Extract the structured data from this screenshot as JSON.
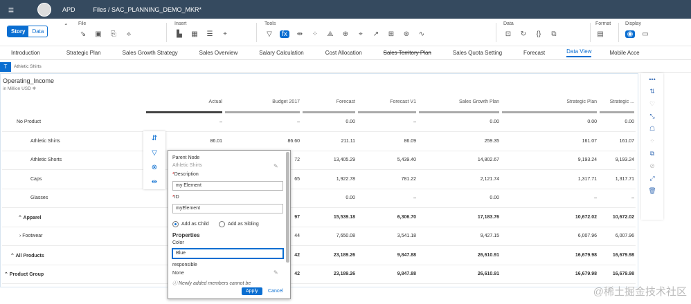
{
  "shell": {
    "app": "APD",
    "crumb": "Files  /  SAC_PLANNING_DEMO_MKR*"
  },
  "toolbar": {
    "story": "Story",
    "data": "Data",
    "groups": [
      {
        "label": "File",
        "icons": [
          "⇘",
          "▣",
          "⎘",
          "⟡"
        ]
      },
      {
        "label": "Insert",
        "icons": [
          "▙",
          "▦",
          "☰",
          "+"
        ]
      },
      {
        "label": "Tools",
        "icons": [
          "▽",
          "fx",
          "⇹",
          "⁘",
          "⟁",
          "⊕",
          "⌖",
          "↗",
          "⊞",
          "⊛",
          "∿"
        ]
      },
      {
        "label": "Data",
        "icons": [
          "⊡",
          "↻",
          "{}",
          "⧉"
        ]
      },
      {
        "label": "Format",
        "icons": [
          "▤"
        ]
      },
      {
        "label": "Display",
        "icons": [
          "◉",
          "▭"
        ]
      }
    ]
  },
  "tabs": [
    "Introduction",
    "Strategic Plan",
    "Sales Growth Strategy",
    "Sales Overview",
    "Salary Calculation",
    "Cost Allocation",
    "Sales Territory Plan",
    "Sales Quota Setting",
    "Forecast",
    "Data View",
    "Mobile Acce"
  ],
  "formula": {
    "badge": "T",
    "value": "Athletic Shirts"
  },
  "table": {
    "title": "Operating_Income",
    "subtitle": "in Million USD  ❄",
    "columns": [
      "Actual",
      "Budget 2017",
      "Forecast",
      "Forecast V1",
      "Sales Growth Plan",
      "Strategic Plan",
      "Strategic ..."
    ],
    "rows": [
      {
        "label": "No Product",
        "values": [
          "–",
          "–",
          "0.00",
          "–",
          "0.00",
          "0.00",
          "0.00"
        ]
      },
      {
        "label": "Athletic Shirts",
        "values": [
          "86.01",
          "86.60",
          "211.11",
          "86.09",
          "259.35",
          "161.07",
          "161.07"
        ]
      },
      {
        "label": "Athletic Shorts",
        "values": [
          "",
          "72",
          "13,405.29",
          "5,439.40",
          "14,802.67",
          "9,193.24",
          "9,193.24"
        ]
      },
      {
        "label": "Caps",
        "values": [
          "",
          "65",
          "1,922.78",
          "781.22",
          "2,121.74",
          "1,317.71",
          "1,317.71"
        ]
      },
      {
        "label": "Glasses",
        "values": [
          "",
          "",
          "0.00",
          "–",
          "0.00",
          "–",
          "–"
        ]
      },
      {
        "label": "⌃ Apparel",
        "values": [
          "",
          "97",
          "15,539.18",
          "6,306.70",
          "17,183.76",
          "10,672.02",
          "10,672.02"
        ]
      },
      {
        "label": "› Footwear",
        "values": [
          "",
          "44",
          "7,650.08",
          "3,541.18",
          "9,427.15",
          "6,007.96",
          "6,007.96"
        ]
      },
      {
        "label": "⌃ All Products",
        "values": [
          "",
          "42",
          "23,189.26",
          "9,847.88",
          "26,610.91",
          "16,679.98",
          "16,679.98"
        ]
      },
      {
        "label": "⌃ Product Group",
        "values": [
          "",
          "42",
          "23,189.26",
          "9,847.88",
          "26,610.91",
          "16,679.98",
          "16,679.98"
        ]
      }
    ]
  },
  "popover": {
    "parent_label": "Parent Node",
    "parent_value": "Athletic Shirts",
    "desc_label": "Description",
    "desc_value": "my Element",
    "id_label": "ID",
    "id_value": "myElement",
    "child": "Add as Child",
    "sibling": "Add as Sibling",
    "props": "Properties",
    "color_label": "Color",
    "color_value": "Blue",
    "resp_label": "responsible",
    "resp_value": "None",
    "note": "Newly added members cannot be",
    "apply": "Apply",
    "cancel": "Cancel"
  },
  "watermark": "@稀土掘金技术社区"
}
